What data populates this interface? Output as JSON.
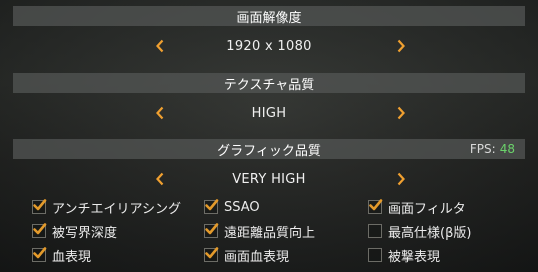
{
  "resolution": {
    "title": "画面解像度",
    "value": "1920 x 1080"
  },
  "texture": {
    "title": "テクスチャ品質",
    "value": "HIGH"
  },
  "graphics": {
    "title": "グラフィック品質",
    "fps_label": "FPS:",
    "fps_value": "48",
    "value": "VERY HIGH"
  },
  "options": [
    {
      "label": "アンチエイリアシング",
      "checked": true
    },
    {
      "label": "SSAO",
      "checked": true
    },
    {
      "label": "画面フィルタ",
      "checked": true
    },
    {
      "label": "被写界深度",
      "checked": true
    },
    {
      "label": "遠距離品質向上",
      "checked": true
    },
    {
      "label": "最高仕様(β版)",
      "checked": false
    },
    {
      "label": "血表現",
      "checked": true
    },
    {
      "label": "画面血表現",
      "checked": true
    },
    {
      "label": "被撃表現",
      "checked": false
    }
  ],
  "colors": {
    "accent": "#f0a030",
    "fps": "#6bd36b",
    "header_bg": "#555856",
    "check": "#e39a2b"
  },
  "icons": {
    "left": "chevron-left-icon",
    "right": "chevron-right-icon",
    "check": "checkmark-icon"
  }
}
